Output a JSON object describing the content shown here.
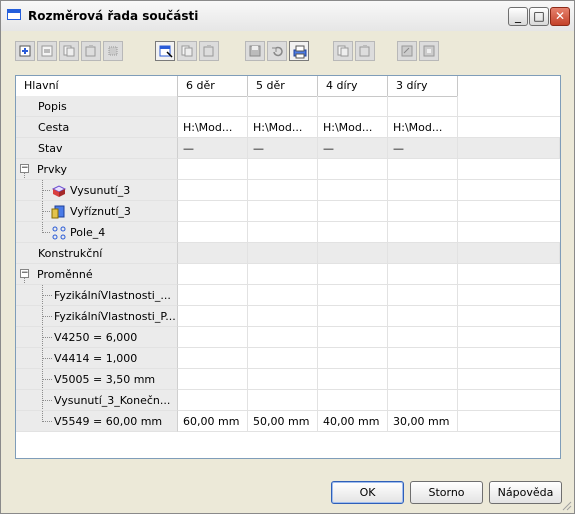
{
  "window": {
    "title": "Rozměrová řada součásti"
  },
  "titlebar_buttons": {
    "minimize": "_",
    "maximize": "□",
    "close": "✕"
  },
  "toolbar": {
    "icons": [
      "insert-row-icon",
      "delete-row-icon",
      "copy-row-icon",
      "paste-row-icon",
      "properties-icon",
      "select-cell-icon",
      "copy-column-icon",
      "paste-column-icon",
      "save-icon",
      "undo-icon",
      "print-icon",
      "copy-icon",
      "paste-icon",
      "export-icon",
      "import-icon"
    ]
  },
  "grid": {
    "columns": [
      "Hlavní",
      "6 děr",
      "5 děr",
      "4 díry",
      "3 díry"
    ],
    "rows": [
      {
        "label": "Popis",
        "cells": [
          "",
          "",
          "",
          ""
        ]
      },
      {
        "label": "Cesta",
        "cells": [
          "H:\\Mod...",
          "H:\\Mod...",
          "H:\\Mod...",
          "H:\\Mod..."
        ]
      },
      {
        "label": "Stav",
        "cells": [
          "—",
          "—",
          "—",
          "—"
        ]
      },
      {
        "label": "Prvky",
        "cells": [
          "",
          "",
          "",
          ""
        ],
        "toggle": "−"
      },
      {
        "label": "Vysunutí_3",
        "cells": [
          "",
          "",
          "",
          ""
        ],
        "icon": "extrude-icon"
      },
      {
        "label": "Vyříznutí_3",
        "cells": [
          "",
          "",
          "",
          ""
        ],
        "icon": "cut-icon"
      },
      {
        "label": "Pole_4",
        "cells": [
          "",
          "",
          "",
          ""
        ],
        "icon": "pattern-icon"
      },
      {
        "label": "Konstrukční",
        "cells": [
          "",
          "",
          "",
          ""
        ]
      },
      {
        "label": "Proměnné",
        "cells": [
          "",
          "",
          "",
          ""
        ],
        "toggle": "−"
      },
      {
        "label": "FyzikálníVlastnosti_...",
        "cells": [
          "",
          "",
          "",
          ""
        ]
      },
      {
        "label": "FyzikálníVlastnosti_P...",
        "cells": [
          "",
          "",
          "",
          ""
        ]
      },
      {
        "label": "V4250 = 6,000",
        "cells": [
          "",
          "",
          "",
          ""
        ]
      },
      {
        "label": "V4414 = 1,000",
        "cells": [
          "",
          "",
          "",
          ""
        ]
      },
      {
        "label": "V5005 = 3,50 mm",
        "cells": [
          "",
          "",
          "",
          ""
        ]
      },
      {
        "label": "Vysunutí_3_Konečn...",
        "cells": [
          "",
          "",
          "",
          ""
        ]
      },
      {
        "label": "V5549 = 60,00 mm",
        "cells": [
          "60,00 mm",
          "50,00 mm",
          "40,00 mm",
          "30,00 mm"
        ]
      }
    ]
  },
  "buttons": {
    "ok": "OK",
    "cancel": "Storno",
    "help": "Nápověda"
  }
}
